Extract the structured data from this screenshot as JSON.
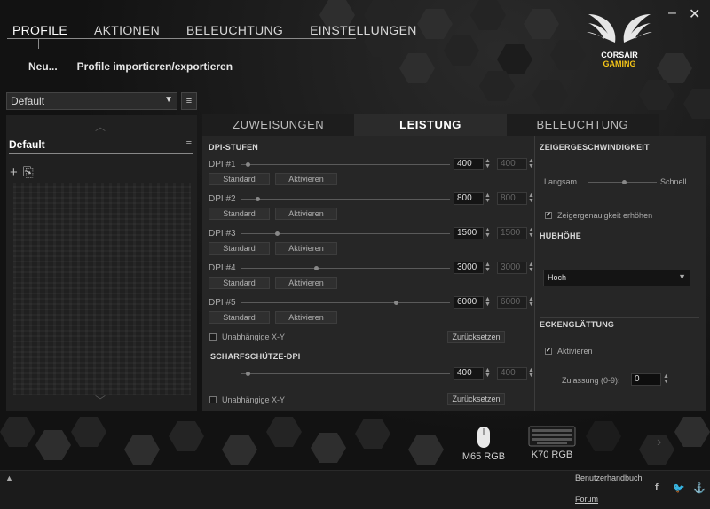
{
  "window": {
    "minimize": "–",
    "close": "✕"
  },
  "nav": {
    "items": [
      "PROFILE",
      "AKTIONEN",
      "BELEUCHTUNG",
      "EINSTELLUNGEN"
    ],
    "active_index": 0
  },
  "logo": {
    "line1": "CORSAIR",
    "line2": "GAMING"
  },
  "subnav": {
    "new": "Neu...",
    "import_export": "Profile importieren/exportieren"
  },
  "profile_select": {
    "value": "Default"
  },
  "profile_list": {
    "items": [
      "Default"
    ]
  },
  "tabs": [
    "ZUWEISUNGEN",
    "LEISTUNG",
    "BELEUCHTUNG"
  ],
  "active_tab": 1,
  "dpi": {
    "section_title": "DPI-STUFEN",
    "standard_label": "Standard",
    "activate_label": "Aktivieren",
    "stages": [
      {
        "label": "DPI #1",
        "value": "400",
        "y_value": "400",
        "level": 0.02
      },
      {
        "label": "DPI #2",
        "value": "800",
        "y_value": "800",
        "level": 0.07
      },
      {
        "label": "DPI #3",
        "value": "1500",
        "y_value": "1500",
        "level": 0.16
      },
      {
        "label": "DPI #4",
        "value": "3000",
        "y_value": "3000",
        "level": 0.35
      },
      {
        "label": "DPI #5",
        "value": "6000",
        "y_value": "6000",
        "level": 0.73
      }
    ],
    "independent_xy": "Unabhängige X-Y",
    "reset": "Zurücksetzen"
  },
  "sniper": {
    "title": "SCHARFSCHÜTZE-DPI",
    "value": "400",
    "y_value": "400",
    "level": 0.02,
    "independent_xy": "Unabhängige X-Y",
    "reset": "Zurücksetzen"
  },
  "pointer_speed": {
    "title": "ZEIGERGESCHWINDIGKEIT",
    "slow": "Langsam",
    "fast": "Schnell",
    "level": 0.5,
    "precision_label": "Zeigergenauigkeit erhöhen",
    "precision_checked": true
  },
  "lift_height": {
    "title": "HUBHÖHE",
    "value": "Hoch"
  },
  "angle_snapping": {
    "title": "ECKENGLÄTTUNG",
    "activate_label": "Aktivieren",
    "activate_checked": true,
    "tolerance_label": "Zulassung (0-9):",
    "tolerance_value": "0"
  },
  "devices": [
    "M65 RGB",
    "K70 RGB"
  ],
  "footer": {
    "manual": "Benutzerhandbuch",
    "forum": "Forum"
  },
  "colors": {
    "accent": "#f5c518",
    "panel": "#262626",
    "background": "#161616"
  }
}
